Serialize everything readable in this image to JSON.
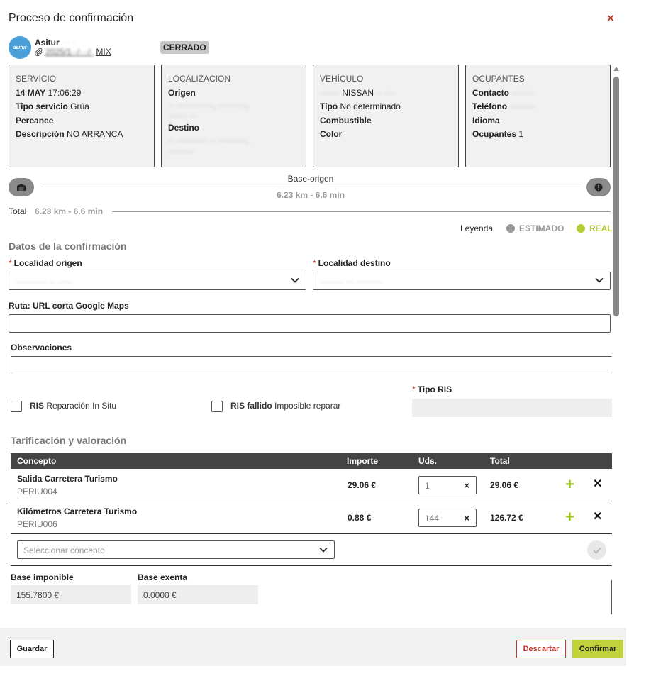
{
  "modal": {
    "title": "Proceso de confirmación",
    "close_symbol": "×"
  },
  "header": {
    "logo_text": "asitur",
    "company": "Asitur",
    "company_extra": "· · ·",
    "file_ref_blurred": "2025/1··/···/·",
    "file_ref_suffix": "MIX",
    "status_badge": "CERRADO"
  },
  "cards": {
    "servicio": {
      "head": "SERVICIO",
      "date": "14 MAY",
      "time": "17:06:29",
      "tipo_label": "Tipo servicio",
      "tipo_value": "Grúa",
      "percance_label": "Percance",
      "descripcion_label": "Descripción",
      "descripcion_value": "NO ARRANCA"
    },
    "localizacion": {
      "head": "LOCALIZACIÓN",
      "origen_label": "Origen",
      "origen_value": "·· ·············, ··········,",
      "origen_value2": "······· ··",
      "destino_label": "Destino",
      "destino_value": "·· ··········· ·· ··········,",
      "destino_value2": "·········"
    },
    "vehiculo": {
      "head": "VEHÍCULO",
      "plate_blurred": "·······",
      "brand": "NISSAN",
      "model_blurred": "·· ····",
      "tipo_label": "Tipo",
      "tipo_value": "No determinado",
      "combustible_label": "Combustible",
      "color_label": "Color"
    },
    "ocupantes": {
      "head": "OCUPANTES",
      "contacto_label": "Contacto",
      "contacto_value": "········",
      "telefono_label": "Teléfono",
      "telefono_value": "·········",
      "idioma_label": "Idioma",
      "ocupantes_label": "Ocupantes",
      "ocupantes_value": "1"
    }
  },
  "route": {
    "label": "Base-origen",
    "distance": "6.23 km - 6.6 min",
    "total_label": "Total",
    "total_value": "6.23 km - 6.6 min"
  },
  "legend": {
    "label": "Leyenda",
    "estimado": "ESTIMADO",
    "real": "REAL",
    "estimado_color": "#999999",
    "real_color": "#b5cc34"
  },
  "form": {
    "section_title": "Datos de la confirmación",
    "required_mark": "*",
    "origen_label": "Localidad origen",
    "origen_value": "··········· ·· ·····",
    "destino_label": "Localidad destino",
    "destino_value": "········ ··· ·········",
    "ruta_label": "Ruta: URL corta Google Maps",
    "observaciones_label": "Observaciones",
    "ris_bold": "RIS",
    "ris_text": "Reparación In Situ",
    "ris_fallido_bold": "RIS fallido",
    "ris_fallido_text": "Imposible reparar",
    "tipo_ris_label": "Tipo RIS"
  },
  "pricing": {
    "section_title": "Tarificación y valoración",
    "columns": {
      "concepto": "Concepto",
      "importe": "Importe",
      "uds": "Uds.",
      "total": "Total"
    },
    "rows": [
      {
        "name": "Salida Carretera Turismo",
        "code": "PERIU004",
        "price": "29.06 €",
        "qty": "1",
        "total": "29.06 €"
      },
      {
        "name": "Kilómetros Carretera Turismo",
        "code": "PERIU006",
        "price": "0.88 €",
        "qty": "144",
        "total": "126.72 €"
      }
    ],
    "concept_placeholder": "Seleccionar concepto",
    "base_imponible_label": "Base imponible",
    "base_imponible_value": "155.7800 €",
    "base_exenta_label": "Base exenta",
    "base_exenta_value": "0.0000 €"
  },
  "footer": {
    "save": "Guardar",
    "discard": "Descartar",
    "confirm": "Confirmar"
  }
}
